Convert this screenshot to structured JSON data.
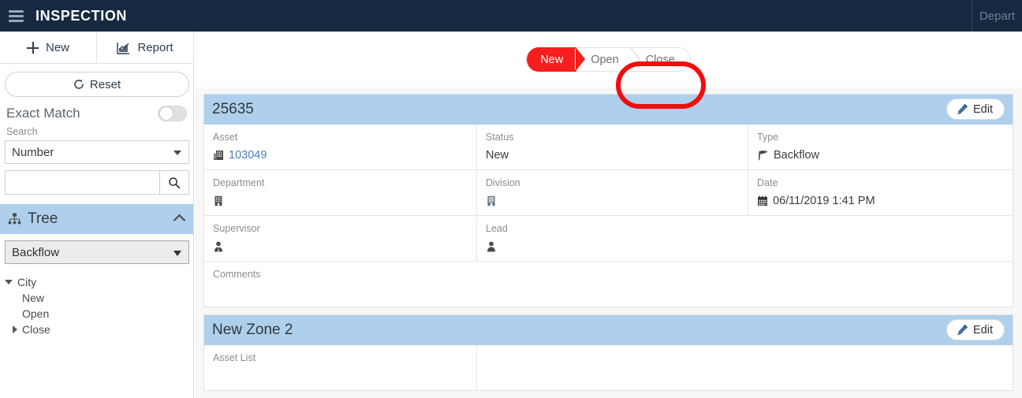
{
  "topbar": {
    "title": "INSPECTION",
    "menu_icon": "hamburger-icon",
    "right_link": "Depart"
  },
  "sidebar": {
    "tools": [
      {
        "label": "New",
        "icon": "plus-icon"
      },
      {
        "label": "Report",
        "icon": "chart-report-icon"
      }
    ],
    "reset_label": "Reset",
    "reset_icon": "refresh-icon",
    "exact_match_label": "Exact Match",
    "exact_match_on": false,
    "search_label": "Search",
    "search_field_selected": "Number",
    "search_field_options": [
      "Number"
    ],
    "search_value": "",
    "search_placeholder": "",
    "search_icon": "magnifier-icon",
    "tree": {
      "header": "Tree",
      "header_icon": "sitemap-icon",
      "collapse_icon": "chevron-up-icon",
      "selected": "Backflow",
      "options": [
        "Backflow"
      ],
      "nodes": [
        {
          "label": "City",
          "level": 1,
          "twisty": "down"
        },
        {
          "label": "New",
          "level": 2,
          "twisty": "none"
        },
        {
          "label": "Open",
          "level": 2,
          "twisty": "none"
        },
        {
          "label": "Close",
          "level": 2,
          "twisty": "right"
        }
      ]
    }
  },
  "main": {
    "steps": [
      {
        "label": "New",
        "active": true
      },
      {
        "label": "Open",
        "active": false
      },
      {
        "label": "Close",
        "active": false
      }
    ],
    "annotation": {
      "shape": "circle",
      "color": "#f20d0d",
      "target": "Close"
    },
    "cards": [
      {
        "title": "25635",
        "edit_label": "Edit",
        "edit_icon": "pencil-icon",
        "rows": [
          [
            {
              "label": "Asset",
              "value": "103049",
              "icon": "building-icon",
              "link": true,
              "span": "c1"
            },
            {
              "label": "Status",
              "value": "New",
              "icon": "",
              "link": false,
              "span": "c2"
            },
            {
              "label": "Type",
              "value": "Backflow",
              "icon": "flag-icon",
              "link": false,
              "span": "c3"
            }
          ],
          [
            {
              "label": "Department",
              "value": "",
              "icon": "building-icon",
              "link": false,
              "span": "c1"
            },
            {
              "label": "Division",
              "value": "",
              "icon": "building-alt-icon",
              "link": false,
              "span": "c2"
            },
            {
              "label": "Date",
              "value": "06/11/2019 1:41 PM",
              "icon": "calendar-icon",
              "link": false,
              "span": "c3"
            }
          ],
          [
            {
              "label": "Supervisor",
              "value": "",
              "icon": "person-tie-icon",
              "link": false,
              "span": "w2"
            },
            {
              "label": "Lead",
              "value": "",
              "icon": "person-icon",
              "link": false,
              "span": "rest"
            }
          ],
          [
            {
              "label": "Comments",
              "value": "",
              "icon": "",
              "link": false,
              "span": "full"
            }
          ]
        ]
      },
      {
        "title": "New Zone 2",
        "edit_label": "Edit",
        "edit_icon": "pencil-icon",
        "rows": [
          [
            {
              "label": "Asset List",
              "value": "",
              "icon": "",
              "link": false,
              "span": "half"
            },
            {
              "label": "",
              "value": "",
              "icon": "",
              "link": false,
              "span": "rest"
            }
          ]
        ]
      }
    ]
  },
  "colors": {
    "topbar_bg": "#152a41",
    "card_header_bg": "#aed0ec",
    "accent_red": "#f71e1e",
    "link_blue": "#4a7ebb",
    "panel_bg": "#f7f7f7"
  }
}
